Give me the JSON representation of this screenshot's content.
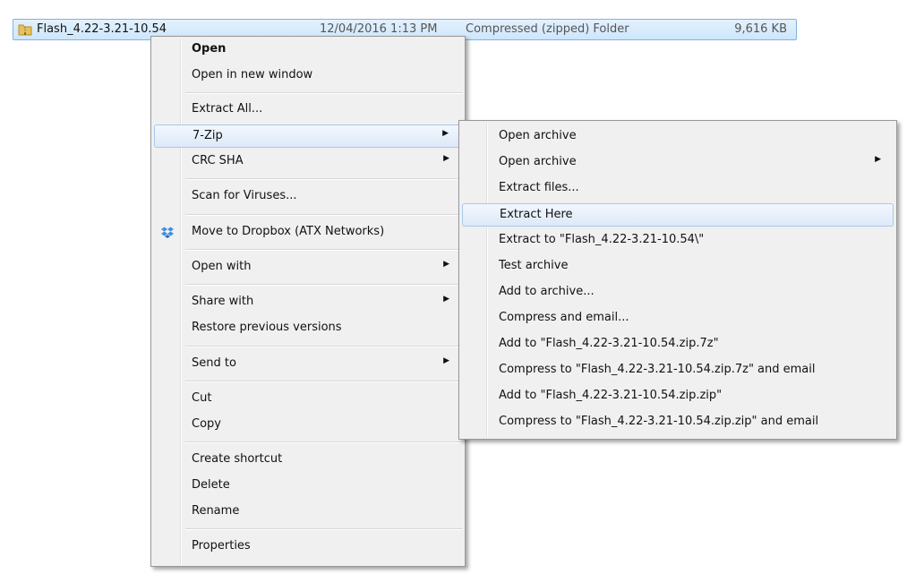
{
  "file": {
    "name": "Flash_4.22-3.21-10.54",
    "date": "12/04/2016 1:13 PM",
    "type": "Compressed (zipped) Folder",
    "size": "9,616 KB"
  },
  "context_menu": {
    "open": "Open",
    "open_new_window": "Open in new window",
    "extract_all": "Extract All...",
    "seven_zip": "7-Zip",
    "crc_sha": "CRC SHA",
    "scan_viruses": "Scan for Viruses...",
    "move_dropbox": "Move to Dropbox (ATX Networks)",
    "open_with": "Open with",
    "share_with": "Share with",
    "restore_versions": "Restore previous versions",
    "send_to": "Send to",
    "cut": "Cut",
    "copy": "Copy",
    "create_shortcut": "Create shortcut",
    "delete": "Delete",
    "rename": "Rename",
    "properties": "Properties"
  },
  "submenu_arrow": "▶",
  "zip_submenu": {
    "open_archive": "Open archive",
    "open_archive_2": "Open archive",
    "extract_files": "Extract files...",
    "extract_here": "Extract Here",
    "extract_to": "Extract to \"Flash_4.22-3.21-10.54\\\"",
    "test_archive": "Test archive",
    "add_to_archive": "Add to archive...",
    "compress_email": "Compress and email...",
    "add_7z": "Add to \"Flash_4.22-3.21-10.54.zip.7z\"",
    "compress_7z_email": "Compress to \"Flash_4.22-3.21-10.54.zip.7z\" and email",
    "add_zip": "Add to \"Flash_4.22-3.21-10.54.zip.zip\"",
    "compress_zip_email": "Compress to \"Flash_4.22-3.21-10.54.zip.zip\" and email"
  },
  "colors": {
    "selection": "#cde6fb",
    "menu_bg": "#f0f0f0",
    "highlight_border": "#a8c8ee"
  }
}
